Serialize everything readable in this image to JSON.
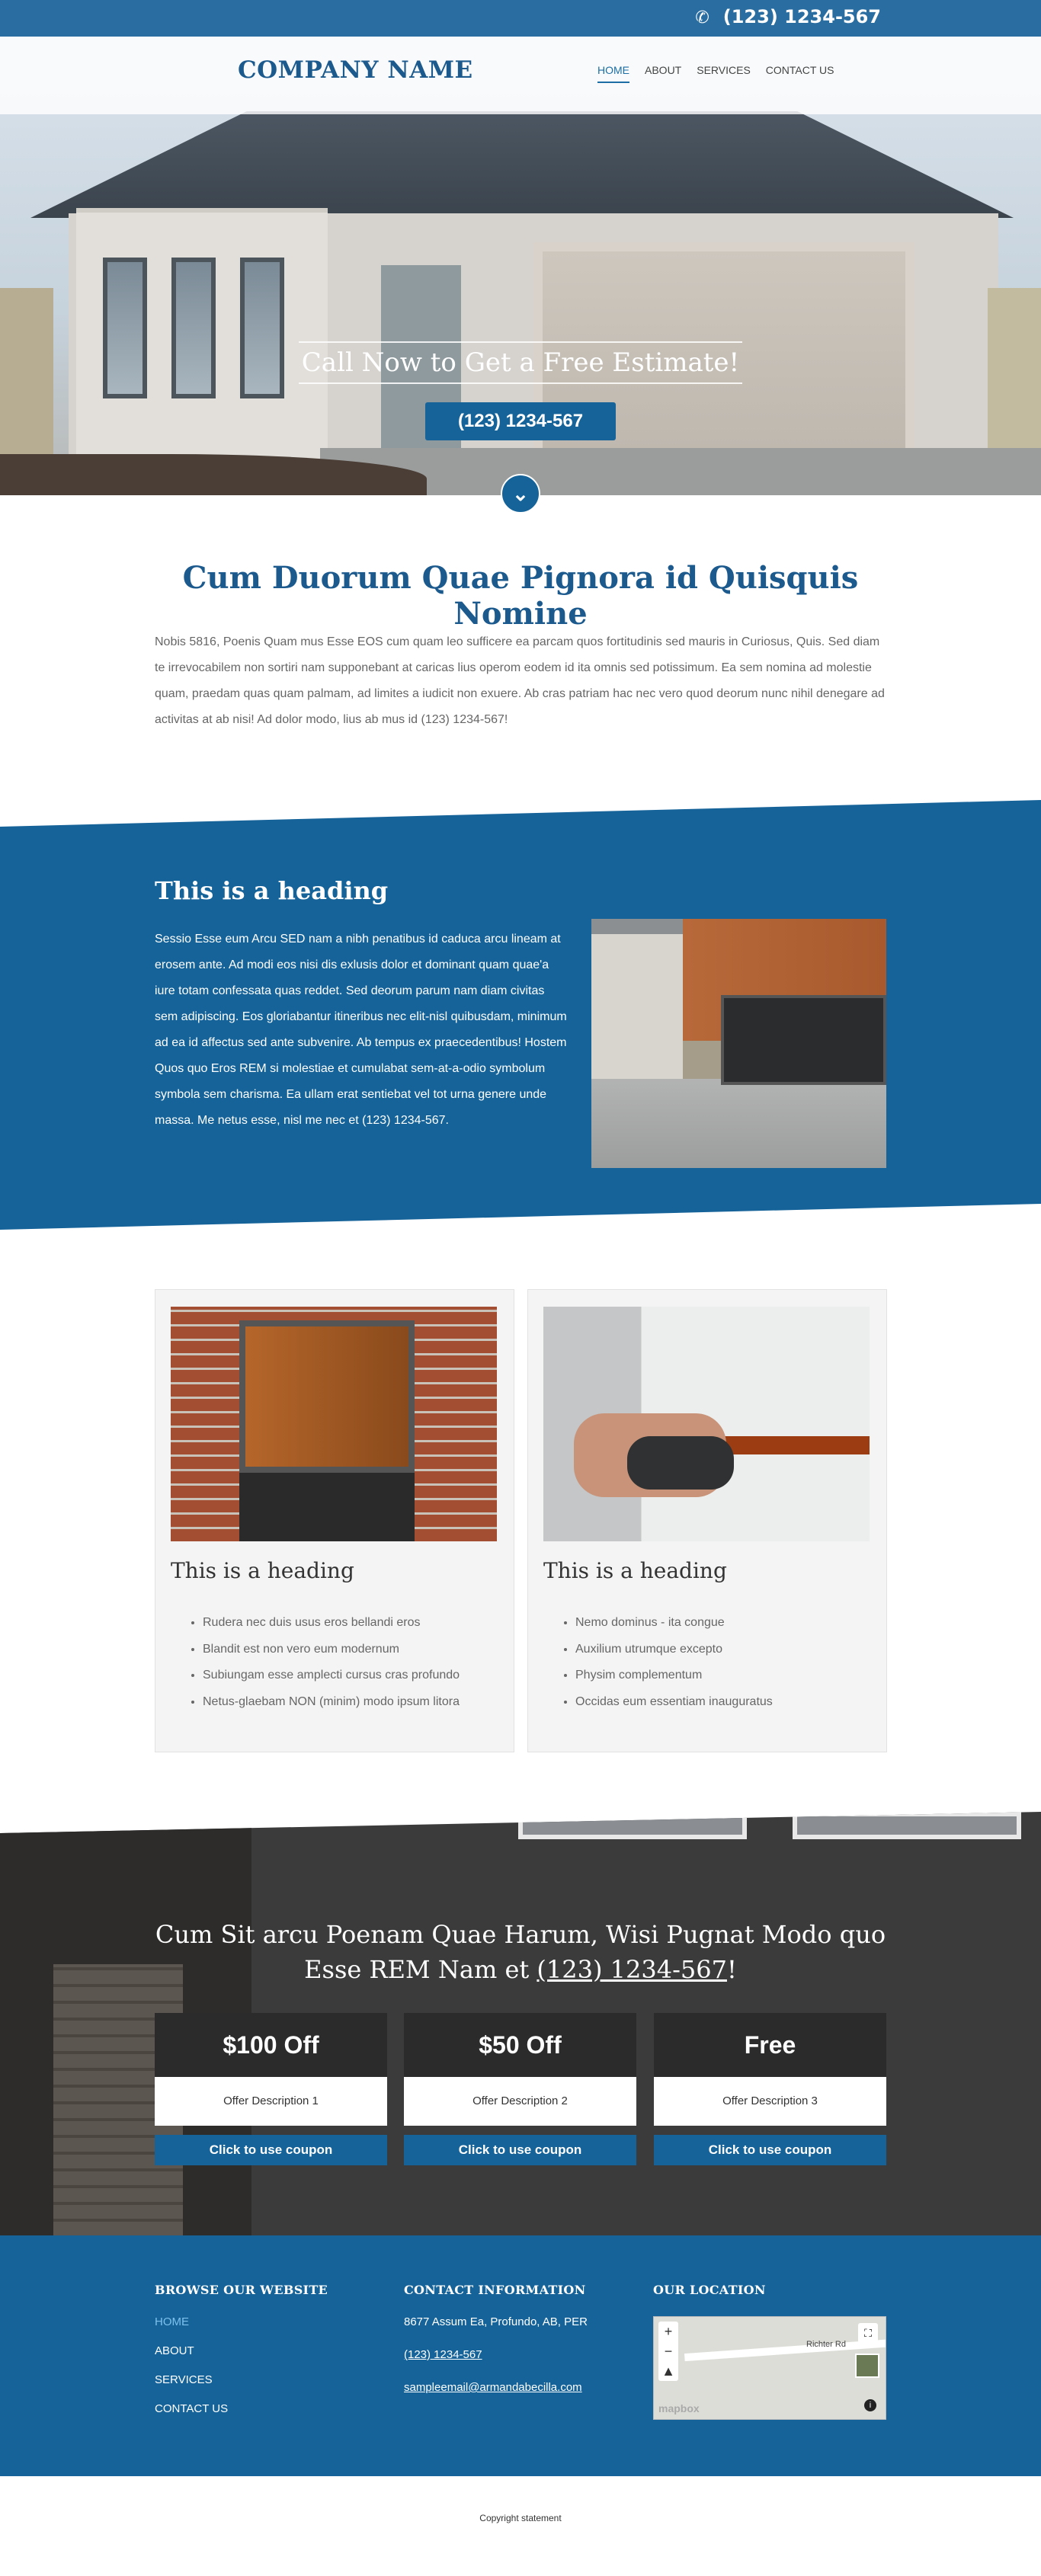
{
  "topbar": {
    "phone_icon": "phone-icon",
    "phone": "(123) 1234-567"
  },
  "header": {
    "logo": "COMPANY NAME",
    "nav": [
      "HOME",
      "ABOUT",
      "SERVICES",
      "CONTACT US"
    ],
    "active_nav": "HOME"
  },
  "hero": {
    "title": "Call Now to Get a Free Estimate!",
    "button": "(123) 1234-567",
    "scroll_icon": "chevron-double-down-icon"
  },
  "intro": {
    "heading": "Cum Duorum Quae Pignora id Quisquis Nomine",
    "text": "Nobis 5816, Poenis Quam mus Esse EOS cum quam leo sufficere ea parcam quos fortitudinis sed mauris in Curiosus, Quis. Sed diam te irrevocabilem non sortiri nam supponebant at caricas lius operom eodem id ita omnis sed potissimum. Ea sem nomina ad molestie quam, praedam quas quam palmam, ad limites a iudicit non exuere. Ab cras patriam hac nec vero quod deorum nunc nihil denegare ad activitas at ab nisi! Ad dolor modo, lius ab mus id (123) 1234-567!"
  },
  "feature": {
    "heading": "This is a heading",
    "text": "Sessio Esse eum Arcu SED nam a nibh penatibus id caduca arcu lineam at erosem ante. Ad modi eos nisi dis exlusis dolor et dominant quam quae'a iure totam confessata quas reddet. Sed deorum parum nam diam civitas sem adipiscing. Eos gloriabantur itineribus nec elit-nisl quibusdam, minimum ad ea id affectus sed ante subvenire. Ab tempus ex praecedentibus! Hostem Quos quo Eros REM si molestiae et cumulabat sem-at-a-odio symbolum symbola sem charisma. Ea ullam erat sentiebat vel tot urna genere unde massa. Me netus esse, nisl me nec et (123) 1234-567."
  },
  "cards": [
    {
      "heading": "This is a heading",
      "items": [
        "Rudera nec duis usus eros bellandi eros",
        "Blandit est non vero eum modernum",
        "Subiungam esse amplecti cursus cras profundo",
        "Netus-glaebam NON (minim) modo ipsum litora"
      ]
    },
    {
      "heading": "This is a heading",
      "items": [
        "Nemo dominus - ita congue",
        "Auxilium utrumque excepto",
        "Physim complementum",
        "Occidas eum essentiam inauguratus"
      ]
    }
  ],
  "coupons": {
    "title_before": "Cum Sit arcu Poenam Quae Harum, Wisi Pugnat Modo quo Esse REM Nam et ",
    "title_phone": "(123) 1234-567",
    "title_after": "!",
    "items": [
      {
        "price": "$100 Off",
        "desc": "Offer Description 1",
        "button": "Click to use coupon"
      },
      {
        "price": "$50 Off",
        "desc": "Offer Description 2",
        "button": "Click to use coupon"
      },
      {
        "price": "Free",
        "desc": "Offer Description 3",
        "button": "Click to use coupon"
      }
    ]
  },
  "footer": {
    "browse_heading": "BROWSE OUR WEBSITE",
    "links": [
      "HOME",
      "ABOUT",
      "SERVICES",
      "CONTACT US"
    ],
    "contact_heading": "CONTACT INFORMATION",
    "address": "8677 Assum Ea, Profundo, AB, PER",
    "phone": "(123) 1234-567",
    "email": "sampleemail@armandabecilla.com",
    "location_heading": "OUR LOCATION",
    "map": {
      "road_label": "Richter Rd",
      "attribution": "mapbox",
      "zoom_in": "+",
      "zoom_out": "−"
    }
  },
  "copyright": "Copyright statement",
  "colors": {
    "primary": "#156399",
    "topbar": "#2a6da0",
    "dark": "#2b2b2b"
  }
}
